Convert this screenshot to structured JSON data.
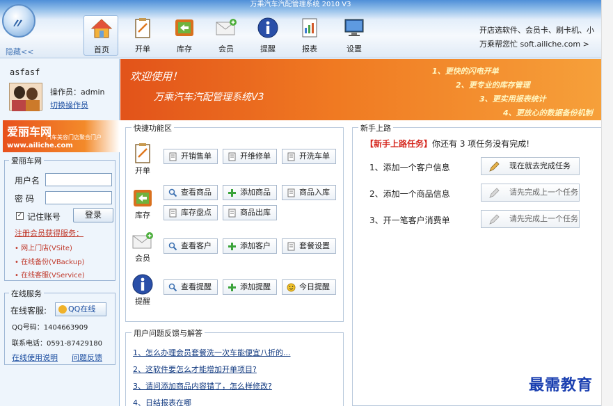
{
  "window": {
    "title": "万乘汽车汽配管理系统 2010 V3"
  },
  "header": {
    "hide_link": "隐藏<<",
    "nav": [
      {
        "label": "首页",
        "icon": "home-icon"
      },
      {
        "label": "开单",
        "icon": "clipboard-icon"
      },
      {
        "label": "库存",
        "icon": "box-icon"
      },
      {
        "label": "会员",
        "icon": "envelope-icon"
      },
      {
        "label": "提醒",
        "icon": "info-icon"
      },
      {
        "label": "报表",
        "icon": "report-icon"
      },
      {
        "label": "设置",
        "icon": "monitor-icon"
      }
    ],
    "promo_line1": "开店选软件、会员卡、刷卡机、小",
    "promo_line2": "万乘帮您忙  soft.ailiche.com >"
  },
  "sidebar": {
    "username": "asfasf",
    "operator_line": "操作员：admin",
    "switch_operator": "切换操作员",
    "brand": {
      "name": "爱丽车网",
      "slogan": "汽车美容门店聚合门户",
      "url": "www.ailiche.com"
    },
    "login": {
      "legend": "爱丽车网",
      "user_label": "用户名",
      "pwd_label": "密  码",
      "remember": "记住账号",
      "login_btn": "登录",
      "register": "注册会员获得服务：",
      "services": [
        "• 网上门店(VSite)",
        "• 在线备份(VBackup)",
        "• 在线客服(VService)"
      ]
    },
    "online": {
      "legend": "在线服务",
      "cs_label": "在线客服:",
      "qq_btn": "QQ在线",
      "qq_number": "QQ号码：1404663909",
      "phone": "联系电话：0591-87429180",
      "help_link": "在线使用说明",
      "feedback_link": "问题反馈"
    }
  },
  "banner": {
    "welcome": "欢迎使用！",
    "system_name": "万乘汽车汽配管理系统V3",
    "features": [
      "1、更快的闪电开单",
      "2、更专业的库存管理",
      "3、更实用报表统计",
      "4、更放心的数据备份机制"
    ]
  },
  "quick": {
    "legend": "快捷功能区",
    "groups": [
      {
        "label": "开单",
        "buttons": [
          "开销售单",
          "开维修单",
          "开洗车单"
        ]
      },
      {
        "label": "库存",
        "buttons": [
          "查看商品",
          "添加商品",
          "商品入库",
          "库存盘点",
          "商品出库"
        ]
      },
      {
        "label": "会员",
        "buttons": [
          "查看客户",
          "添加客户",
          "套餐设置"
        ]
      },
      {
        "label": "提醒",
        "buttons": [
          "查看提醒",
          "添加提醒",
          "今日提醒"
        ]
      }
    ]
  },
  "newbie": {
    "legend": "新手上路",
    "title_tag": "【新手上路任务】",
    "title_rest": "你还有 3 项任务没有完成!",
    "tasks": [
      {
        "label": "1、添加一个客户信息",
        "button": "现在就去完成任务"
      },
      {
        "label": "2、添加一个商品信息",
        "button": "请先完成上一个任务"
      },
      {
        "label": "3、开一笔客户消费单",
        "button": "请先完成上一个任务"
      }
    ]
  },
  "faq": {
    "legend": "用户问题反馈与解答",
    "items": [
      "1、怎么办理会员套餐洗一次车能便宜八折的...",
      "2、这软件要怎么才能增加开单项目?",
      "3、请问添加商品内容错了，怎么样修改?",
      "4、日结报表在哪"
    ]
  },
  "watermark": "最需教育",
  "colors": {
    "banner_orange": "#f07a22",
    "task_red": "#d5271e",
    "link_blue": "#1a4da0"
  }
}
